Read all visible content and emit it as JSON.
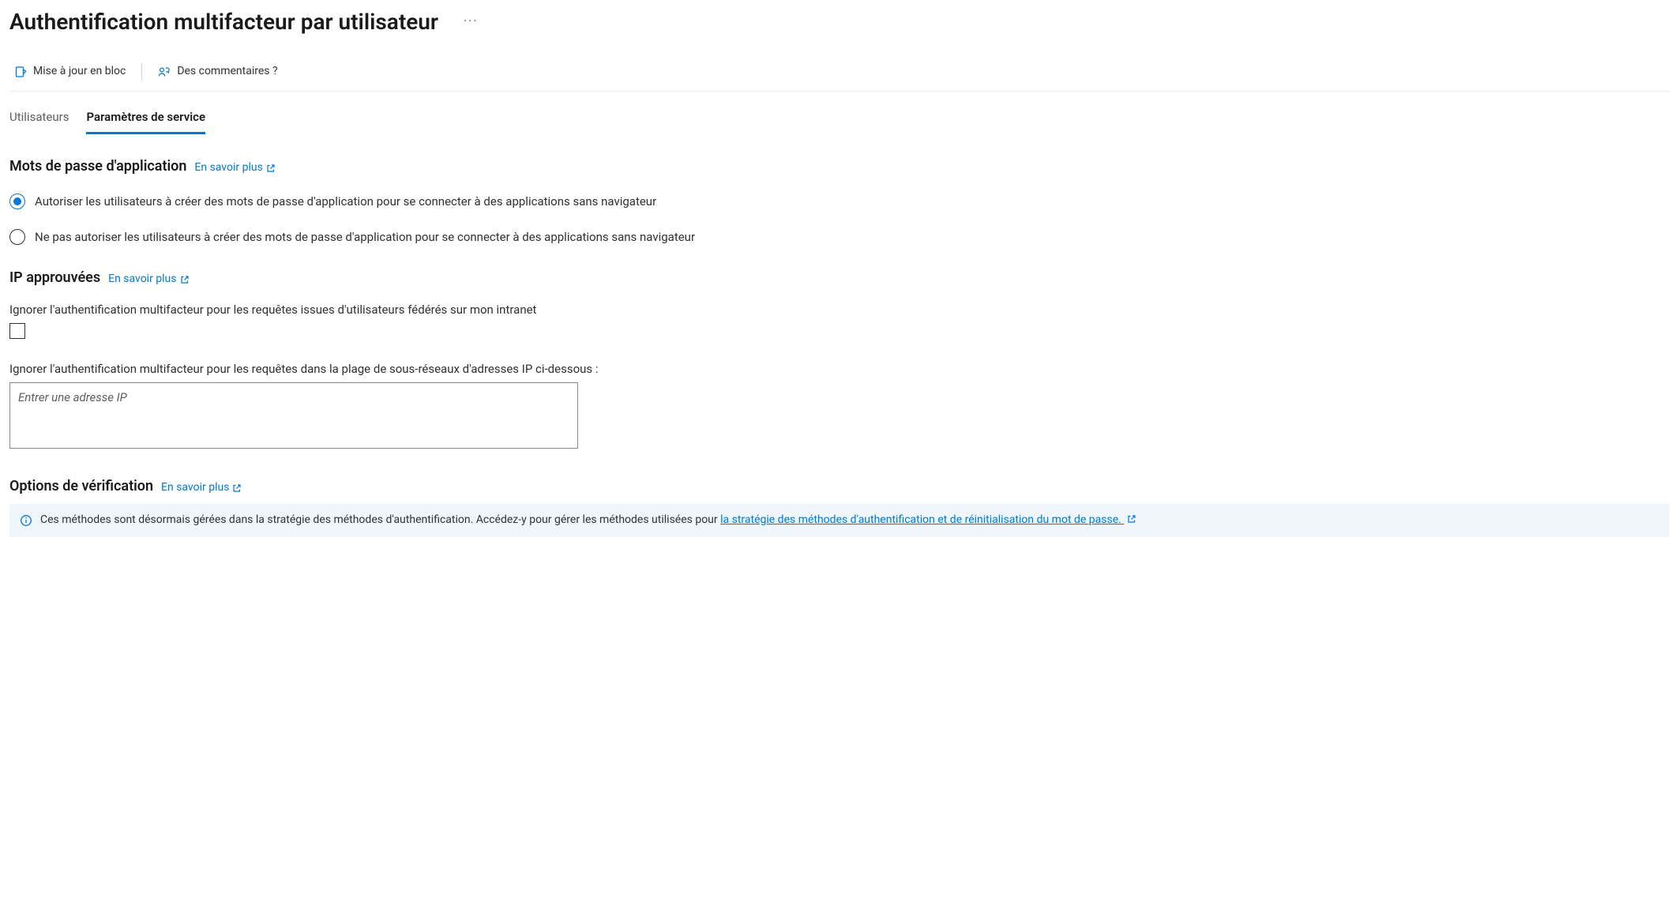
{
  "header": {
    "title": "Authentification multifacteur par utilisateur"
  },
  "toolbar": {
    "bulk_update": "Mise à jour en bloc",
    "feedback": "Des commentaires ?"
  },
  "tabs": {
    "users": "Utilisateurs",
    "service_settings": "Paramètres de service"
  },
  "sections": {
    "app_passwords": {
      "heading": "Mots de passe d'application",
      "learn_more": "En savoir plus",
      "radio_allow": "Autoriser les utilisateurs à créer des mots de passe d'application pour se connecter à des applications sans navigateur",
      "radio_disallow": "Ne pas autoriser les utilisateurs à créer des mots de passe d'application pour se connecter à des applications sans navigateur",
      "selected": "allow"
    },
    "trusted_ips": {
      "heading": "IP approuvées",
      "learn_more": "En savoir plus",
      "skip_federated_label": "Ignorer l'authentification multifacteur pour les requêtes issues d'utilisateurs fédérés sur mon intranet",
      "skip_federated_checked": false,
      "subnet_label": "Ignorer l'authentification multifacteur pour les requêtes dans la plage de sous-réseaux d'adresses IP ci-dessous :",
      "subnet_placeholder": "Entrer une adresse IP",
      "subnet_value": ""
    },
    "verification_options": {
      "heading": "Options de vérification",
      "learn_more": "En savoir plus",
      "banner_text_prefix": "Ces méthodes sont désormais gérées dans la stratégie des méthodes d'authentification. Accédez-y pour gérer les méthodes utilisées pour ",
      "banner_link": "la stratégie des méthodes d'authentification et de réinitialisation du mot de passe."
    }
  },
  "colors": {
    "accent": "#0078d4",
    "info_bg": "#eff6fc"
  }
}
